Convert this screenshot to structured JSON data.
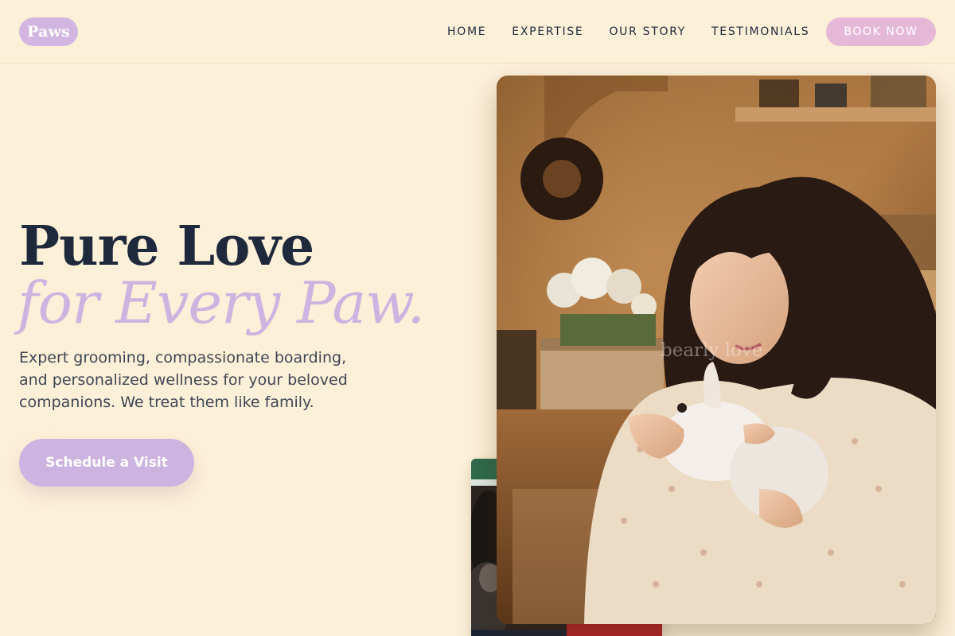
{
  "brand": {
    "logo_text": "Paws",
    "colors": {
      "background": "#fdf0d8",
      "accent": "#cdb3df",
      "book_button": "#e6b8d8",
      "heading": "#1e293b"
    }
  },
  "nav": {
    "items": [
      {
        "label": "HOME"
      },
      {
        "label": "EXPERTISE"
      },
      {
        "label": "OUR STORY"
      },
      {
        "label": "TESTIMONIALS"
      }
    ],
    "book_label": "BOOK NOW"
  },
  "hero": {
    "title_line1": "Pure Love",
    "title_line2": "for Every Paw.",
    "lead": "Expert grooming, compassionate boarding, and personalized wellness for your beloved companions. We treat them like family.",
    "cta_label": "Schedule a Visit"
  },
  "photos": {
    "main_caption": "bearly love"
  }
}
